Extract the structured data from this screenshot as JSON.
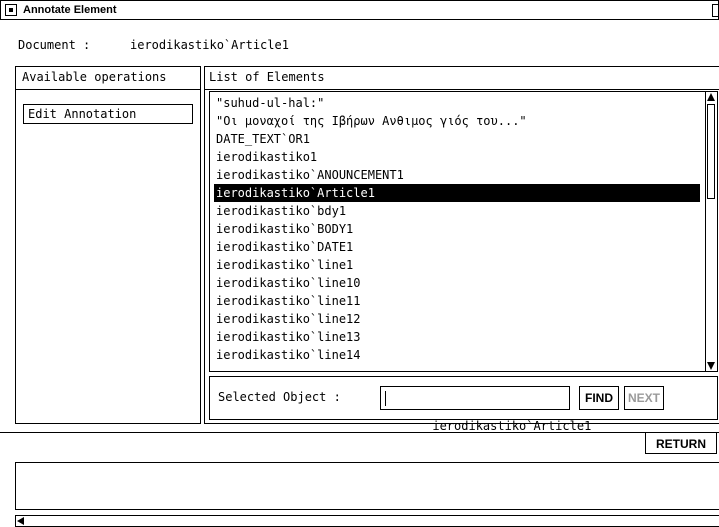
{
  "window": {
    "title": "Annotate Element"
  },
  "document": {
    "label": "Document :",
    "value": "ierodikastiko`Article1"
  },
  "operations": {
    "header": "Available operations",
    "buttons": [
      {
        "label": "Edit Annotation"
      }
    ]
  },
  "elements": {
    "header": "List of Elements",
    "items": [
      "\"suhud-ul-hal:\"",
      "\"Οι μοναχοί της Ιβήρων Ανθιμος γιός του...\"",
      "DATE_TEXT`OR1",
      "ierodikastiko1",
      "ierodikastiko`ANOUNCEMENT1",
      "ierodikastiko`Article1",
      "ierodikastiko`bdy1",
      "ierodikastiko`BODY1",
      "ierodikastiko`DATE1",
      "ierodikastiko`line1",
      "ierodikastiko`line10",
      "ierodikastiko`line11",
      "ierodikastiko`line12",
      "ierodikastiko`line13",
      "ierodikastiko`line14"
    ],
    "selected_index": 5
  },
  "selection": {
    "label": "Selected Object :",
    "value": "ierodikastiko`Article1",
    "find_label": "FIND",
    "next_label": "NEXT"
  },
  "footer": {
    "return_label": "RETURN",
    "message": ""
  }
}
